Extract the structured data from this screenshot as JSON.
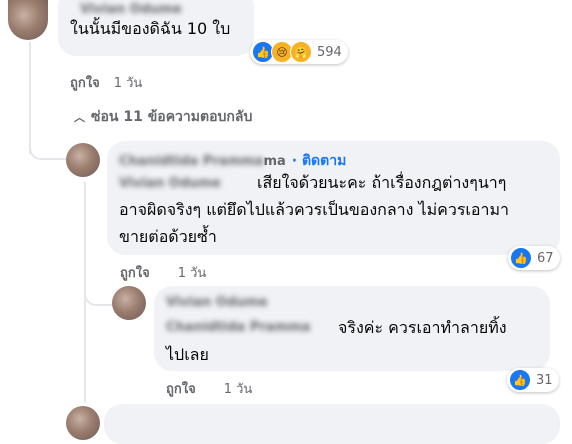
{
  "comment1": {
    "author_blurred": "Vivian Odume",
    "text": "ในนั้นมีของดิฉัน 10 ใบ",
    "reaction_count": "594",
    "like_label": "ถูกใจ",
    "time": "1 วัน"
  },
  "hide_replies": {
    "label": "ซ่อน 11 ข้อความตอบกลับ"
  },
  "reply1": {
    "author_blurred": "Chanidtida Pramma",
    "author_tail": "ma",
    "follow_label": "· ติดตาม",
    "mention_blurred": "Vivian Odume",
    "text_line1": "เสียใจด้วยนะคะ ถ้าเรื่องกฎต่างๆนาๆ",
    "text_line2": "อาจผิดจริงๆ แต่ยึดไปแล้วควรเป็นของกลาง ไม่ควรเอามา",
    "text_line3": "ขายต่อด้วยซ้ำ",
    "reaction_count": "67",
    "like_label": "ถูกใจ",
    "time": "1 วัน"
  },
  "reply2": {
    "author_blurred": "Vivian Odume",
    "mention_blurred": "Chanidtida Pramma",
    "text_line1": "จริงค่ะ ควรเอาทำลายทิ้ง",
    "text_line2": "ไปเลย",
    "reaction_count": "31",
    "like_label": "ถูกใจ",
    "time": "1 วัน"
  },
  "colors": {
    "accent": "#1877f2",
    "bubble": "#f0f2f5",
    "meta": "#65676b"
  }
}
